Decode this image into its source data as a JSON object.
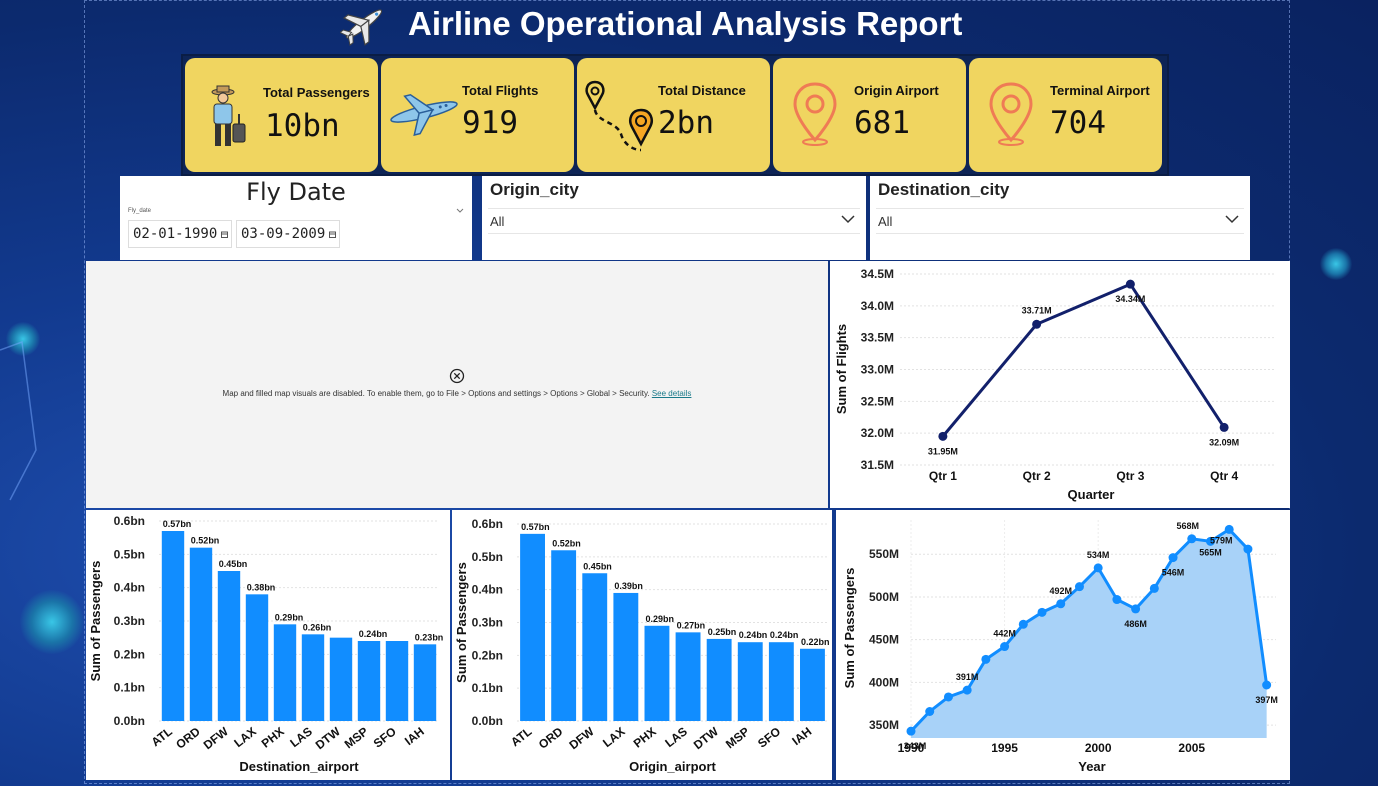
{
  "header": {
    "title": "Airline Operational Analysis Report",
    "icon": "airplane-icon"
  },
  "kpis": [
    {
      "label": "Total Passengers",
      "value": "10bn",
      "icon": "traveler-icon"
    },
    {
      "label": "Total Flights",
      "value": "919",
      "icon": "airplane-icon"
    },
    {
      "label": "Total Distance",
      "value": "2bn",
      "icon": "route-pins-icon"
    },
    {
      "label": "Origin Airport",
      "value": "681",
      "icon": "location-pin-icon"
    },
    {
      "label": "Terminal Airport",
      "value": "704",
      "icon": "location-pin-icon"
    }
  ],
  "filters": {
    "fly_date": {
      "title": "Fly Date",
      "field": "Fly_date",
      "start": "02-01-1990",
      "end": "03-09-2009"
    },
    "origin_city": {
      "title": "Origin_city",
      "value": "All"
    },
    "destination_city": {
      "title": "Destination_city",
      "value": "All"
    }
  },
  "map": {
    "message": "Map and filled map visuals are disabled. To enable them, go to File > Options and settings > Options > Global > Security.",
    "link": "See details"
  },
  "colors": {
    "bar": "#118dff",
    "line_dark": "#12206b",
    "area_fill": "#a8d2f8",
    "kpi_bg": "#f0d560",
    "background": "#123a8f"
  },
  "chart_data": [
    {
      "type": "line",
      "xlabel": "Quarter",
      "ylabel": "Sum of Flights",
      "categories": [
        "Qtr 1",
        "Qtr 2",
        "Qtr 3",
        "Qtr 4"
      ],
      "values": [
        31.95,
        33.71,
        34.34,
        32.09
      ],
      "unit": "M",
      "data_labels": [
        "31.95M",
        "33.71M",
        "34.34M",
        "32.09M"
      ],
      "yticks": [
        "31.5M",
        "32.0M",
        "32.5M",
        "33.0M",
        "33.5M",
        "34.0M",
        "34.5M"
      ],
      "ylim": [
        31.5,
        34.5
      ]
    },
    {
      "type": "bar",
      "xlabel": "Destination_airport",
      "ylabel": "Sum of Passengers",
      "categories": [
        "ATL",
        "ORD",
        "DFW",
        "LAX",
        "PHX",
        "LAS",
        "DTW",
        "MSP",
        "SFO",
        "IAH"
      ],
      "values": [
        0.57,
        0.52,
        0.45,
        0.38,
        0.29,
        0.26,
        0.25,
        0.24,
        0.24,
        0.23
      ],
      "data_labels": [
        "0.57bn",
        "0.52bn",
        "0.45bn",
        "0.38bn",
        "0.29bn",
        "0.26bn",
        "",
        "0.24bn",
        "",
        "0.23bn"
      ],
      "yticks": [
        "0.0bn",
        "0.1bn",
        "0.2bn",
        "0.3bn",
        "0.4bn",
        "0.5bn",
        "0.6bn"
      ],
      "ylim": [
        0,
        0.6
      ]
    },
    {
      "type": "bar",
      "xlabel": "Origin_airport",
      "ylabel": "Sum of Passengers",
      "categories": [
        "ATL",
        "ORD",
        "DFW",
        "LAX",
        "PHX",
        "LAS",
        "DTW",
        "MSP",
        "SFO",
        "IAH"
      ],
      "values": [
        0.57,
        0.52,
        0.45,
        0.39,
        0.29,
        0.27,
        0.25,
        0.24,
        0.24,
        0.22
      ],
      "data_labels": [
        "0.57bn",
        "0.52bn",
        "0.45bn",
        "0.39bn",
        "0.29bn",
        "0.27bn",
        "0.25bn",
        "0.24bn",
        "0.24bn",
        "0.22bn"
      ],
      "yticks": [
        "0.0bn",
        "0.1bn",
        "0.2bn",
        "0.3bn",
        "0.4bn",
        "0.5bn",
        "0.6bn"
      ],
      "ylim": [
        0,
        0.6
      ]
    },
    {
      "type": "area",
      "xlabel": "Year",
      "ylabel": "Sum of Passengers",
      "x": [
        1990,
        1991,
        1992,
        1993,
        1994,
        1995,
        1996,
        1997,
        1998,
        1999,
        2000,
        2001,
        2002,
        2003,
        2004,
        2005,
        2006,
        2007,
        2008,
        2009
      ],
      "values": [
        343,
        366,
        383,
        391,
        427,
        442,
        468,
        482,
        492,
        512,
        534,
        497,
        486,
        510,
        546,
        568,
        565,
        579,
        556,
        397
      ],
      "data_labels": {
        "1990": "343M",
        "1993": "391M",
        "1995": "442M",
        "1998": "492M",
        "2000": "534M",
        "2002": "486M",
        "2004": "546M",
        "2005": "568M",
        "2006": "565M",
        "2007": "579M",
        "2009": "397M"
      },
      "xticks": [
        "1990",
        "1995",
        "2000",
        "2005"
      ],
      "yticks": [
        "350M",
        "400M",
        "450M",
        "500M",
        "550M"
      ],
      "ylim": [
        335,
        590
      ],
      "xlim": [
        1990,
        2009.5
      ]
    }
  ]
}
